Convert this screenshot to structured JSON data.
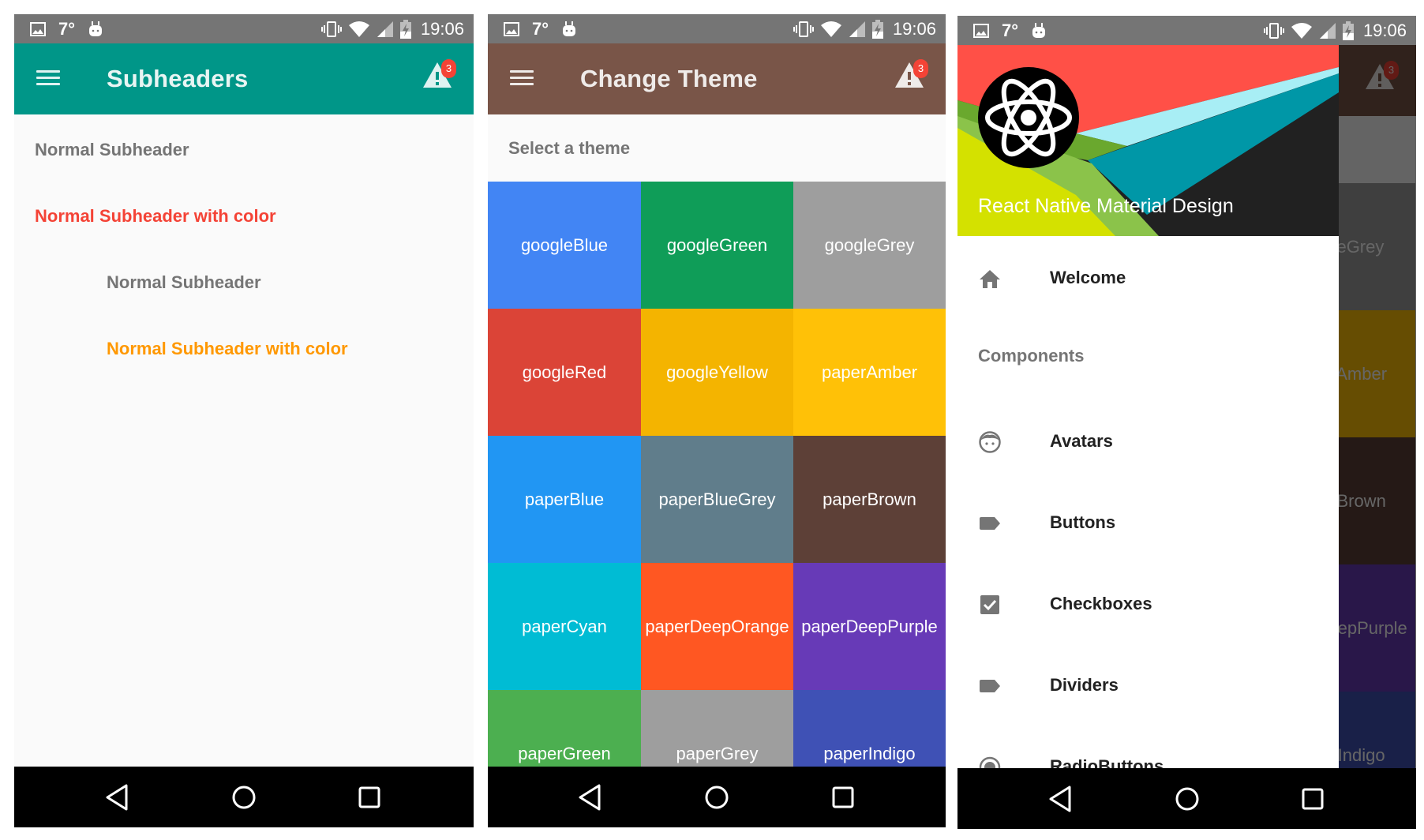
{
  "status_bar": {
    "temperature": "7°",
    "time": "19:06",
    "left_icons": [
      "image-icon",
      "weather-temp",
      "android-icon"
    ],
    "right_icons": [
      "vibrate-icon",
      "wifi-icon",
      "signal-icon",
      "battery-charging-icon"
    ]
  },
  "notification_badge": "3",
  "nav_bar": {
    "buttons": [
      "back",
      "home",
      "recents"
    ]
  },
  "screens": {
    "subheaders": {
      "title": "Subheaders",
      "appbar_color": "#009688",
      "items": [
        {
          "text": "Normal Subheader",
          "color": "#757575",
          "inset": false
        },
        {
          "text": "Normal Subheader with color",
          "color": "#F44336",
          "inset": false
        },
        {
          "text": "Normal Subheader",
          "color": "#757575",
          "inset": true
        },
        {
          "text": "Normal Subheader with color",
          "color": "#FF9800",
          "inset": true
        }
      ]
    },
    "change_theme": {
      "title": "Change Theme",
      "appbar_color": "#795548",
      "subheader": "Select a theme",
      "themes": [
        {
          "name": "googleBlue",
          "color": "#4285F4"
        },
        {
          "name": "googleGreen",
          "color": "#0F9D58"
        },
        {
          "name": "googleGrey",
          "color": "#9E9E9E"
        },
        {
          "name": "googleRed",
          "color": "#DB4437"
        },
        {
          "name": "googleYellow",
          "color": "#F4B400"
        },
        {
          "name": "paperAmber",
          "color": "#FFC107"
        },
        {
          "name": "paperBlue",
          "color": "#2196F3"
        },
        {
          "name": "paperBlueGrey",
          "color": "#607D8B"
        },
        {
          "name": "paperBrown",
          "color": "#5D4037"
        },
        {
          "name": "paperCyan",
          "color": "#00BCD4"
        },
        {
          "name": "paperDeepOrange",
          "color": "#FF5722"
        },
        {
          "name": "paperDeepPurple",
          "color": "#673AB7"
        },
        {
          "name": "paperGreen",
          "color": "#4CAF50"
        },
        {
          "name": "paperGrey",
          "color": "#9E9E9E"
        },
        {
          "name": "paperIndigo",
          "color": "#3F51B5"
        }
      ]
    },
    "drawer": {
      "header_title": "React Native Material Design",
      "items": [
        {
          "type": "item",
          "label": "Welcome",
          "icon": "home-icon"
        },
        {
          "type": "subheader",
          "label": "Components"
        },
        {
          "type": "item",
          "label": "Avatars",
          "icon": "face-icon"
        },
        {
          "type": "item",
          "label": "Buttons",
          "icon": "label-icon"
        },
        {
          "type": "item",
          "label": "Checkboxes",
          "icon": "check-box-icon"
        },
        {
          "type": "item",
          "label": "Dividers",
          "icon": "label-icon"
        },
        {
          "type": "item",
          "label": "RadioButtons",
          "icon": "radio-button-icon"
        }
      ]
    }
  }
}
